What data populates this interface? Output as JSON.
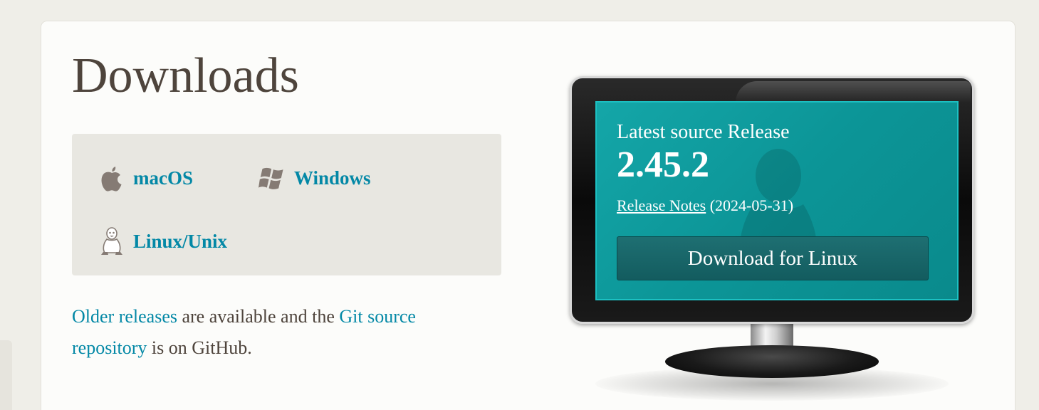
{
  "page": {
    "title": "Downloads"
  },
  "os_links": {
    "macos": {
      "label": "macOS",
      "icon": "apple-icon"
    },
    "windows": {
      "label": "Windows",
      "icon": "windows-icon"
    },
    "linux": {
      "label": "Linux/Unix",
      "icon": "tux-icon"
    }
  },
  "info": {
    "older_releases_link": "Older releases",
    "text_middle": " are available and the ",
    "git_source_link": "Git source repository",
    "text_end": " is on GitHub."
  },
  "release": {
    "heading": "Latest source Release",
    "version": "2.45.2",
    "notes_link": "Release Notes",
    "date": " (2024-05-31)",
    "download_button": "Download for Linux"
  },
  "colors": {
    "link": "#0388a6",
    "heading": "#4e443c",
    "screen": "#0c9597",
    "button": "#1a6569"
  }
}
